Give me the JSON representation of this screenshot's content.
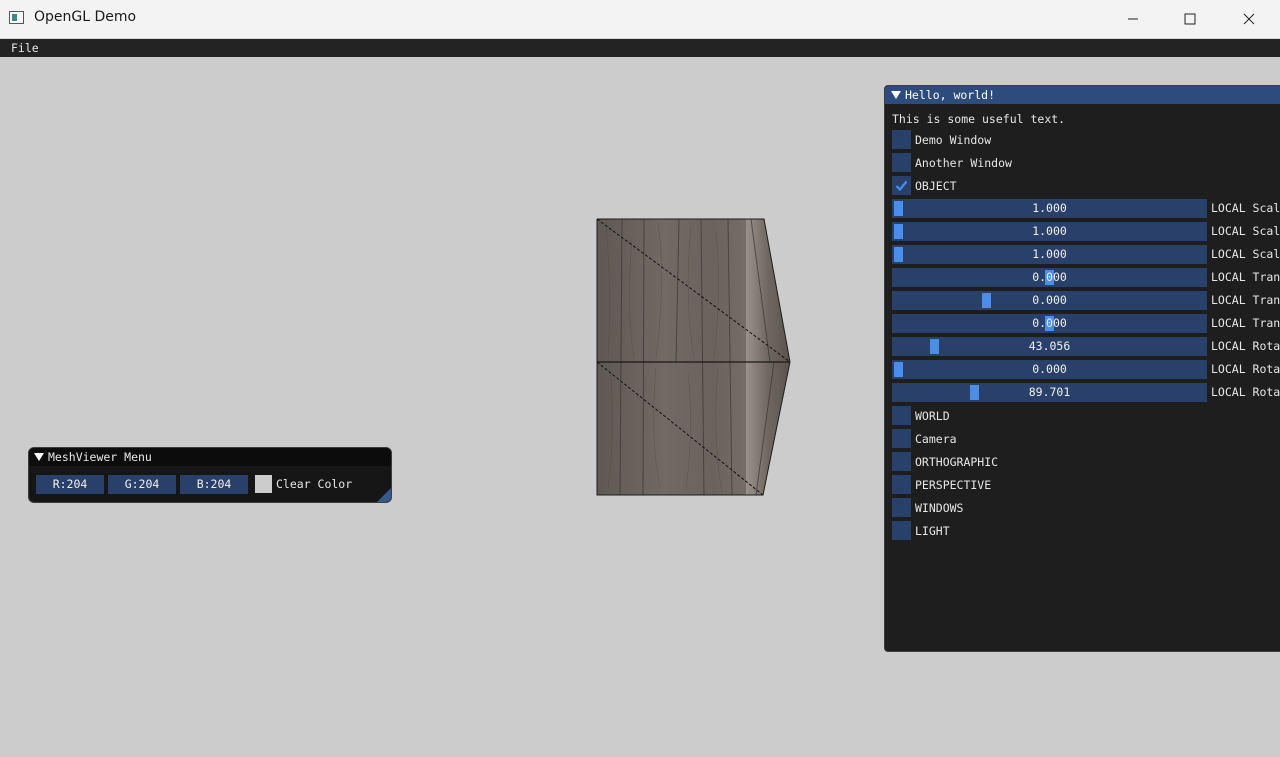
{
  "window": {
    "title": "OpenGL Demo"
  },
  "menubar": {
    "file_label": "File"
  },
  "hello_window": {
    "title": "Hello, world!",
    "text": "This is some useful text.",
    "checkboxes": [
      {
        "label": "Demo Window",
        "checked": false
      },
      {
        "label": "Another Window",
        "checked": false
      },
      {
        "label": "OBJECT",
        "checked": true
      }
    ],
    "sliders": [
      {
        "value": "1.000",
        "label": "LOCAL Scal",
        "fraction": 0.0
      },
      {
        "value": "1.000",
        "label": "LOCAL Scal",
        "fraction": 0.0
      },
      {
        "value": "1.000",
        "label": "LOCAL Scal",
        "fraction": 0.0
      },
      {
        "value": "0.000",
        "label": "LOCAL Tran",
        "fraction": 0.5
      },
      {
        "value": "0.000",
        "label": "LOCAL Tran",
        "fraction": 0.29
      },
      {
        "value": "0.000",
        "label": "LOCAL Tran",
        "fraction": 0.5
      },
      {
        "value": "43.056",
        "label": "LOCAL Rota",
        "fraction": 0.12
      },
      {
        "value": "0.000",
        "label": "LOCAL Rota",
        "fraction": 0.0
      },
      {
        "value": "89.701",
        "label": "LOCAL Rota",
        "fraction": 0.25
      }
    ],
    "sections": [
      "WORLD",
      "Camera",
      "ORTHOGRAPHIC",
      "PERSPECTIVE",
      "WINDOWS",
      "LIGHT"
    ]
  },
  "mesh_viewer": {
    "title": "MeshViewer Menu",
    "r": "R:204",
    "g": "G:204",
    "b": "B:204",
    "clear_color_label": "Clear Color",
    "clear_color": "#cccccc"
  },
  "colors": {
    "accent": "#4a8ee8",
    "frame_bg": "#29416a",
    "title_active": "#2d4c7d",
    "viewport_bg": "#cccccc"
  }
}
